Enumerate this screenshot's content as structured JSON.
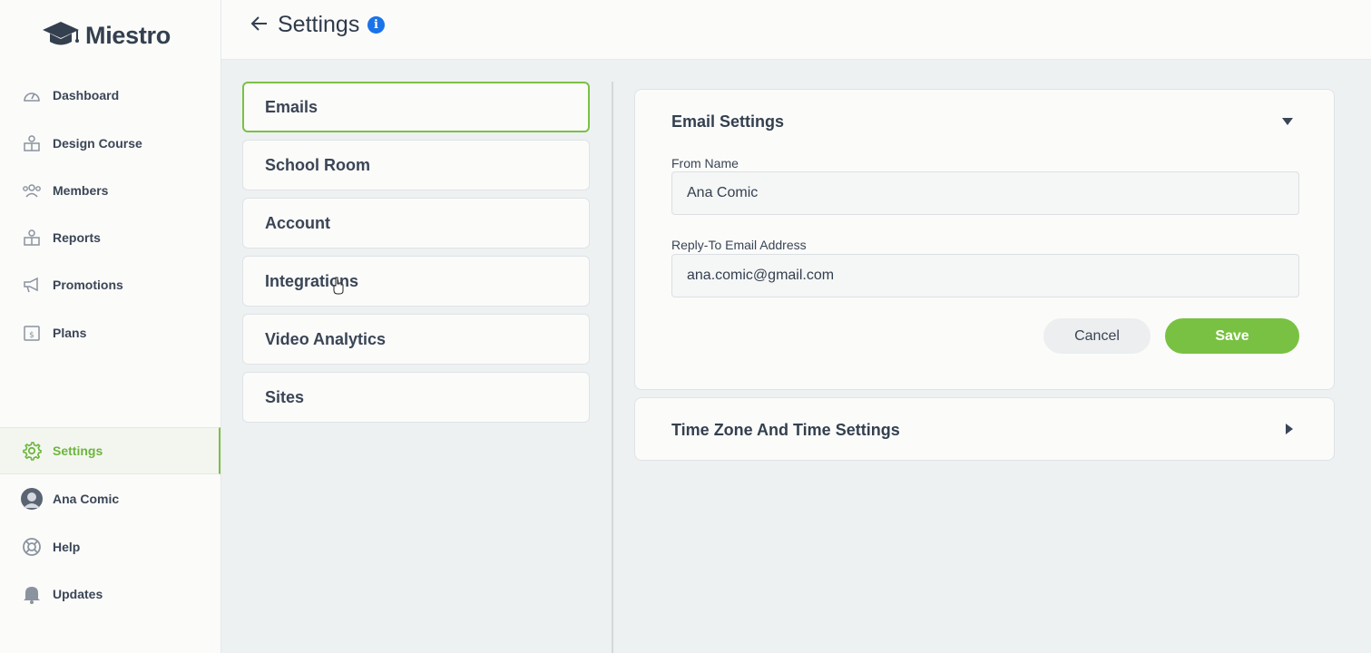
{
  "app": {
    "logo_text": "Miestro"
  },
  "header": {
    "title": "Settings"
  },
  "sidebar": {
    "items": [
      {
        "label": "Dashboard",
        "icon": "gauge-icon"
      },
      {
        "label": "Design Course",
        "icon": "book-reader-icon"
      },
      {
        "label": "Members",
        "icon": "users-icon"
      },
      {
        "label": "Reports",
        "icon": "book-reader-icon"
      },
      {
        "label": "Promotions",
        "icon": "megaphone-icon"
      },
      {
        "label": "Plans",
        "icon": "price-box-icon"
      }
    ],
    "bottom_items": [
      {
        "label": "Settings",
        "icon": "gear-icon",
        "active": true
      },
      {
        "label": "Ana Comic",
        "icon": "avatar-icon"
      },
      {
        "label": "Help",
        "icon": "lifebuoy-icon"
      },
      {
        "label": "Updates",
        "icon": "bell-icon"
      }
    ]
  },
  "settings_tabs": [
    {
      "label": "Emails",
      "active": true
    },
    {
      "label": "School Room"
    },
    {
      "label": "Account"
    },
    {
      "label": "Integrations"
    },
    {
      "label": "Video Analytics"
    },
    {
      "label": "Sites"
    }
  ],
  "email_settings": {
    "title": "Email Settings",
    "from_name_label": "From Name",
    "from_name_value": "Ana Comic",
    "reply_to_label": "Reply-To Email Address",
    "reply_to_value": "ana.comic@gmail.com",
    "cancel_label": "Cancel",
    "save_label": "Save"
  },
  "time_settings": {
    "title": "Time Zone And Time Settings"
  },
  "colors": {
    "accent": "#79c142",
    "info": "#1a73e8",
    "text": "#2f3a4a"
  }
}
